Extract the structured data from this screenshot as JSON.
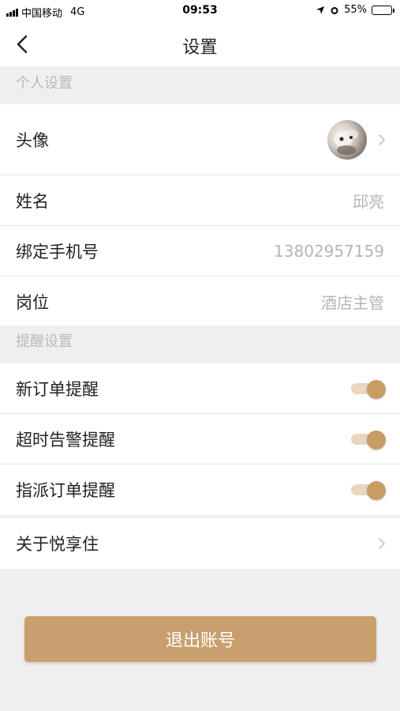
{
  "status_bar": {
    "carrier": "中国移动",
    "network": "4G",
    "time": "09:53",
    "battery_percent": "55%",
    "battery_level": 0.55
  },
  "nav": {
    "title": "设置",
    "back_icon": "chevron-left-icon"
  },
  "personal_section": {
    "header": "个人设置",
    "rows": [
      {
        "label": "头像"
      },
      {
        "label": "姓名",
        "value": "邱亮"
      },
      {
        "label": "绑定手机号",
        "value": "13802957159"
      },
      {
        "label": "岗位",
        "value": "酒店主管"
      }
    ]
  },
  "reminder_section": {
    "header": "提醒设置",
    "rows": [
      {
        "label": "新订单提醒",
        "enabled": true
      },
      {
        "label": "超时告警提醒",
        "enabled": true
      },
      {
        "label": "指派订单提醒",
        "enabled": true
      }
    ]
  },
  "about": {
    "label": "关于悦享住"
  },
  "logout_button": {
    "label": "退出账号"
  },
  "colors": {
    "accent": "#c9a06d",
    "toggle_track": "#e8d6c0",
    "background": "#efefef"
  }
}
